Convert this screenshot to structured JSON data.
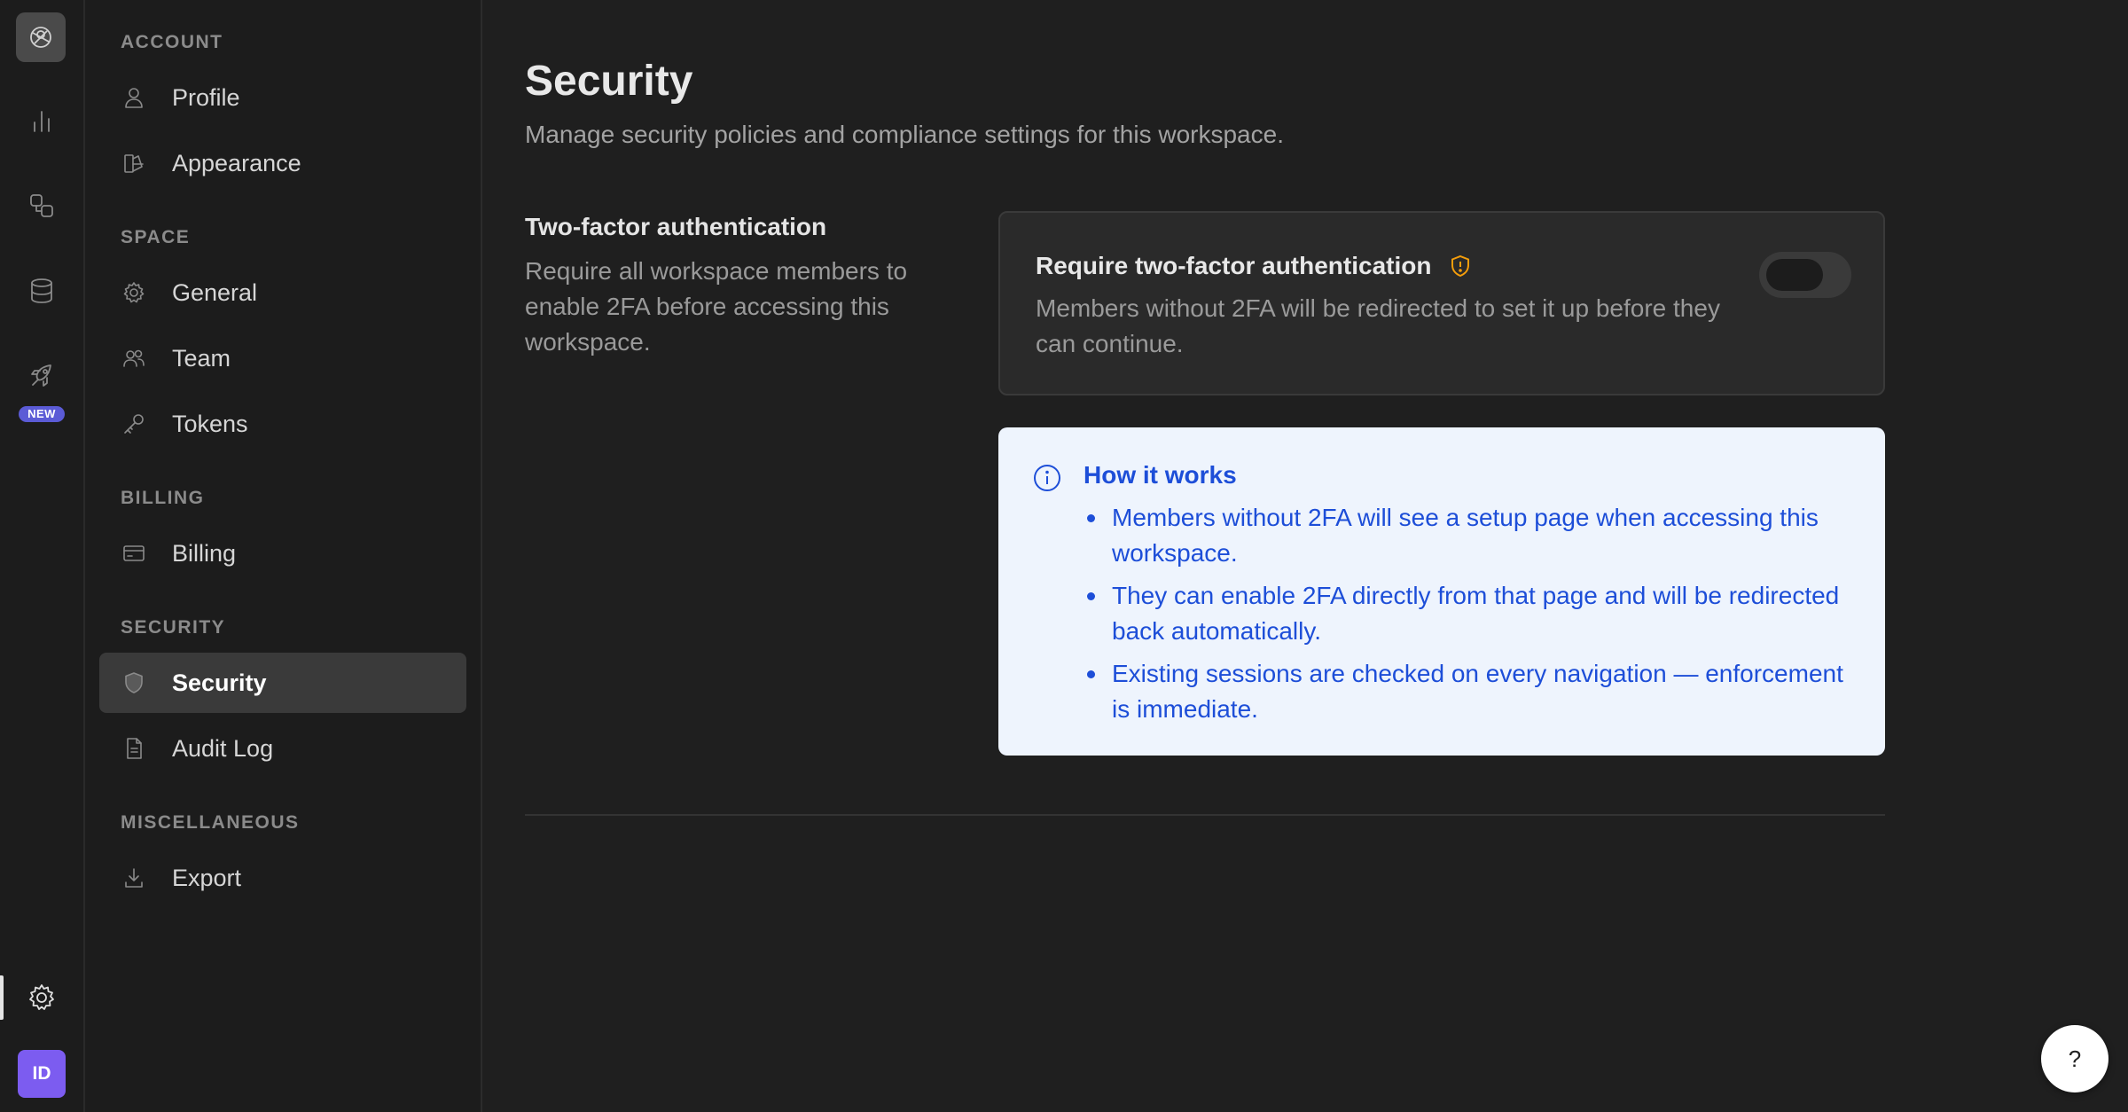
{
  "rail": {
    "new_badge": "NEW",
    "avatar_initials": "ID",
    "icons": [
      "logo-icon",
      "analytics-icon",
      "integrations-icon",
      "database-icon",
      "rocket-icon",
      "settings-icon"
    ]
  },
  "sidebar": {
    "sections": [
      {
        "label": "ACCOUNT",
        "items": [
          {
            "label": "Profile",
            "icon": "user-icon"
          },
          {
            "label": "Appearance",
            "icon": "palette-icon"
          }
        ]
      },
      {
        "label": "SPACE",
        "items": [
          {
            "label": "General",
            "icon": "gear-icon"
          },
          {
            "label": "Team",
            "icon": "users-icon"
          },
          {
            "label": "Tokens",
            "icon": "key-icon"
          }
        ]
      },
      {
        "label": "BILLING",
        "items": [
          {
            "label": "Billing",
            "icon": "credit-card-icon"
          }
        ]
      },
      {
        "label": "SECURITY",
        "items": [
          {
            "label": "Security",
            "icon": "shield-icon",
            "active": true
          },
          {
            "label": "Audit Log",
            "icon": "document-icon"
          }
        ]
      },
      {
        "label": "MISCELLANEOUS",
        "items": [
          {
            "label": "Export",
            "icon": "download-icon"
          }
        ]
      }
    ]
  },
  "main": {
    "title": "Security",
    "subtitle": "Manage security policies and compliance settings for this workspace.",
    "section_title": "Two-factor authentication",
    "section_desc": "Require all workspace members to enable 2FA before accessing this workspace.",
    "card": {
      "title": "Require two-factor authentication",
      "desc": "Members without 2FA will be redirected to set it up before they can continue.",
      "toggle_on": false
    },
    "info": {
      "title": "How it works",
      "items": [
        "Members without 2FA will see a setup page when accessing this workspace.",
        "They can enable 2FA directly from that page and will be redirected back automatically.",
        "Existing sessions are checked on every navigation — enforcement is immediate."
      ]
    }
  },
  "help": {
    "label": "?"
  },
  "colors": {
    "accent_info": "#1d4ed8",
    "badge": "#5b5bd6",
    "avatar": "#7c5cf0",
    "warning": "#f59e0b"
  }
}
